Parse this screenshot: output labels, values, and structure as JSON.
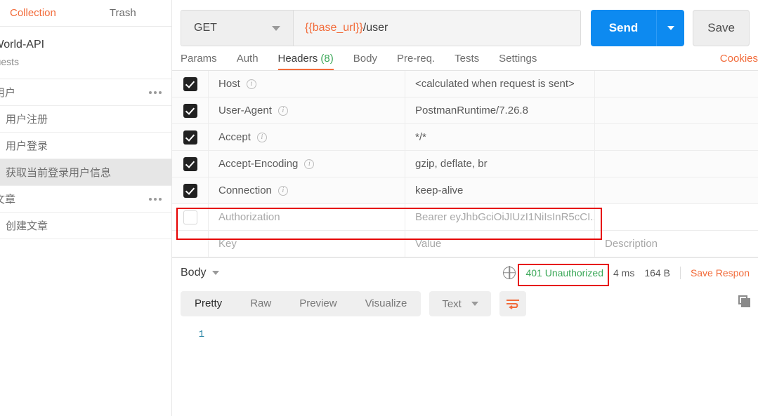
{
  "sidebar": {
    "tabs": [
      {
        "label": "Collection",
        "active": true
      },
      {
        "label": "Trash",
        "active": false
      }
    ],
    "collection": {
      "name": "alWorld-API",
      "subtitle": "equests"
    },
    "items": [
      {
        "label": "用户",
        "type": "folder",
        "selected": false,
        "has_menu": true
      },
      {
        "label": "用户注册",
        "type": "request",
        "selected": false,
        "has_menu": false
      },
      {
        "label": "用户登录",
        "type": "request",
        "selected": false,
        "has_menu": false
      },
      {
        "label": "获取当前登录用户信息",
        "type": "request",
        "selected": true,
        "has_menu": false
      },
      {
        "label": "文章",
        "type": "folder",
        "selected": false,
        "has_menu": true
      },
      {
        "label": "创建文章",
        "type": "request",
        "selected": false,
        "has_menu": false
      }
    ]
  },
  "request": {
    "method": "GET",
    "url_variable": "{{base_url}}",
    "url_path": "/user",
    "send_label": "Send",
    "save_label": "Save",
    "cookies_label": "Cookies",
    "tabs": [
      {
        "label": "Params",
        "count": "",
        "active": false
      },
      {
        "label": "Auth",
        "count": "",
        "active": false
      },
      {
        "label": "Headers",
        "count": "(8)",
        "active": true
      },
      {
        "label": "Body",
        "count": "",
        "active": false
      },
      {
        "label": "Pre-req.",
        "count": "",
        "active": false
      },
      {
        "label": "Tests",
        "count": "",
        "active": false
      },
      {
        "label": "Settings",
        "count": "",
        "active": false
      }
    ]
  },
  "headers_table": {
    "columns": [
      "Key",
      "Value",
      "Description"
    ],
    "rows": [
      {
        "checked": true,
        "key": "Host",
        "info": true,
        "value": "<calculated when request is sent>",
        "description": "",
        "highlighted": false
      },
      {
        "checked": true,
        "key": "User-Agent",
        "info": true,
        "value": "PostmanRuntime/7.26.8",
        "description": "",
        "highlighted": false
      },
      {
        "checked": true,
        "key": "Accept",
        "info": true,
        "value": "*/*",
        "description": "",
        "highlighted": false
      },
      {
        "checked": true,
        "key": "Accept-Encoding",
        "info": true,
        "value": "gzip, deflate, br",
        "description": "",
        "highlighted": false
      },
      {
        "checked": true,
        "key": "Connection",
        "info": true,
        "value": "keep-alive",
        "description": "",
        "highlighted": false
      },
      {
        "checked": false,
        "key": "Authorization",
        "info": false,
        "value": "Bearer eyJhbGciOiJIUzI1NiIsInR5cCI...",
        "description": "",
        "highlighted": true
      }
    ],
    "placeholder_row": {
      "key": "Key",
      "value": "Value",
      "description": "Description"
    }
  },
  "response": {
    "body_label": "Body",
    "status": "401 Unauthorized",
    "time": "4 ms",
    "size": "164 B",
    "save_response_label": "Save Respon",
    "view_tabs": [
      {
        "label": "Pretty",
        "active": true
      },
      {
        "label": "Raw",
        "active": false
      },
      {
        "label": "Preview",
        "active": false
      },
      {
        "label": "Visualize",
        "active": false
      }
    ],
    "format": "Text",
    "lines": [
      {
        "number": "1",
        "content": ""
      }
    ]
  },
  "colors": {
    "accent_orange": "#f26b3a",
    "send_blue": "#0d8af0",
    "status_green": "#3aa757",
    "annotation_red": "#e60000",
    "line_number": "#1f7fa0"
  }
}
